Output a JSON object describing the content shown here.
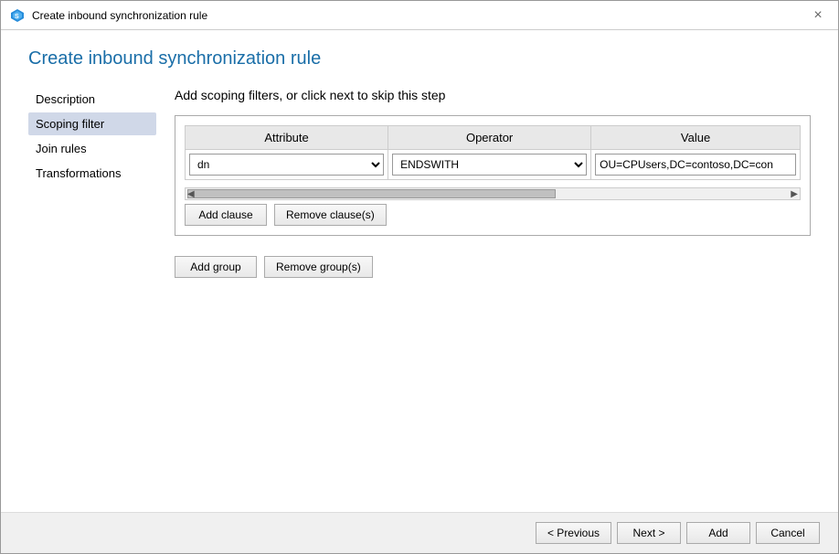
{
  "window": {
    "title": "Create inbound synchronization rule",
    "close_label": "×"
  },
  "page": {
    "heading": "Create inbound synchronization rule",
    "step_heading": "Add scoping filters, or click next to skip this step"
  },
  "sidebar": {
    "items": [
      {
        "id": "description",
        "label": "Description",
        "active": false
      },
      {
        "id": "scoping-filter",
        "label": "Scoping filter",
        "active": true
      },
      {
        "id": "join-rules",
        "label": "Join rules",
        "active": false
      },
      {
        "id": "transformations",
        "label": "Transformations",
        "active": false
      }
    ]
  },
  "filter_table": {
    "columns": [
      "Attribute",
      "Operator",
      "Value"
    ],
    "rows": [
      {
        "attribute": "dn",
        "operator": "ENDSWITH",
        "value": "OU=CPUsers,DC=contoso,DC=con"
      }
    ]
  },
  "buttons": {
    "add_clause": "Add clause",
    "remove_clause": "Remove clause(s)",
    "add_group": "Add group",
    "remove_group": "Remove group(s)",
    "previous": "< Previous",
    "next": "Next >",
    "add": "Add",
    "cancel": "Cancel"
  }
}
